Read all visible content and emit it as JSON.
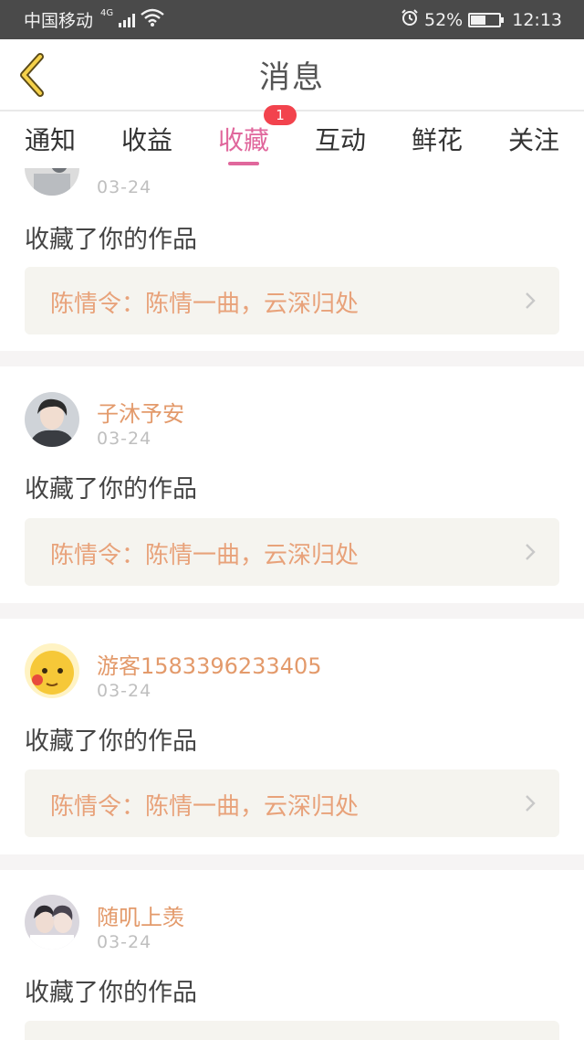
{
  "status_bar": {
    "carrier": "中国移动",
    "network": "4G",
    "battery_percent": "52%",
    "time": "12:13",
    "icons": [
      "signal-icon",
      "wifi-icon",
      "alarm-icon",
      "battery-icon"
    ]
  },
  "header": {
    "title": "消息",
    "back_icon": "chevron-left-icon"
  },
  "tabs": {
    "items": [
      {
        "label": "通知"
      },
      {
        "label": "收益"
      },
      {
        "label": "收藏",
        "active": true,
        "badge": "1"
      },
      {
        "label": "互动"
      },
      {
        "label": "鲜花"
      },
      {
        "label": "关注"
      }
    ]
  },
  "colors": {
    "accent": "#e0679c",
    "badge": "#f2434d",
    "username": "#e39a6b",
    "link_text": "#e8a27a",
    "link_bg": "#f5f4ef"
  },
  "feed": {
    "items": [
      {
        "username": "",
        "date": "03-24",
        "action": "收藏了你的作品",
        "work": "陈情令：陈情一曲，云深归处"
      },
      {
        "username": "子沐予安",
        "date": "03-24",
        "action": "收藏了你的作品",
        "work": "陈情令：陈情一曲，云深归处"
      },
      {
        "username": "游客1583396233405",
        "date": "03-24",
        "action": "收藏了你的作品",
        "work": "陈情令：陈情一曲，云深归处"
      },
      {
        "username": "随叽上羡",
        "date": "03-24",
        "action": "收藏了你的作品",
        "work": ""
      }
    ]
  }
}
